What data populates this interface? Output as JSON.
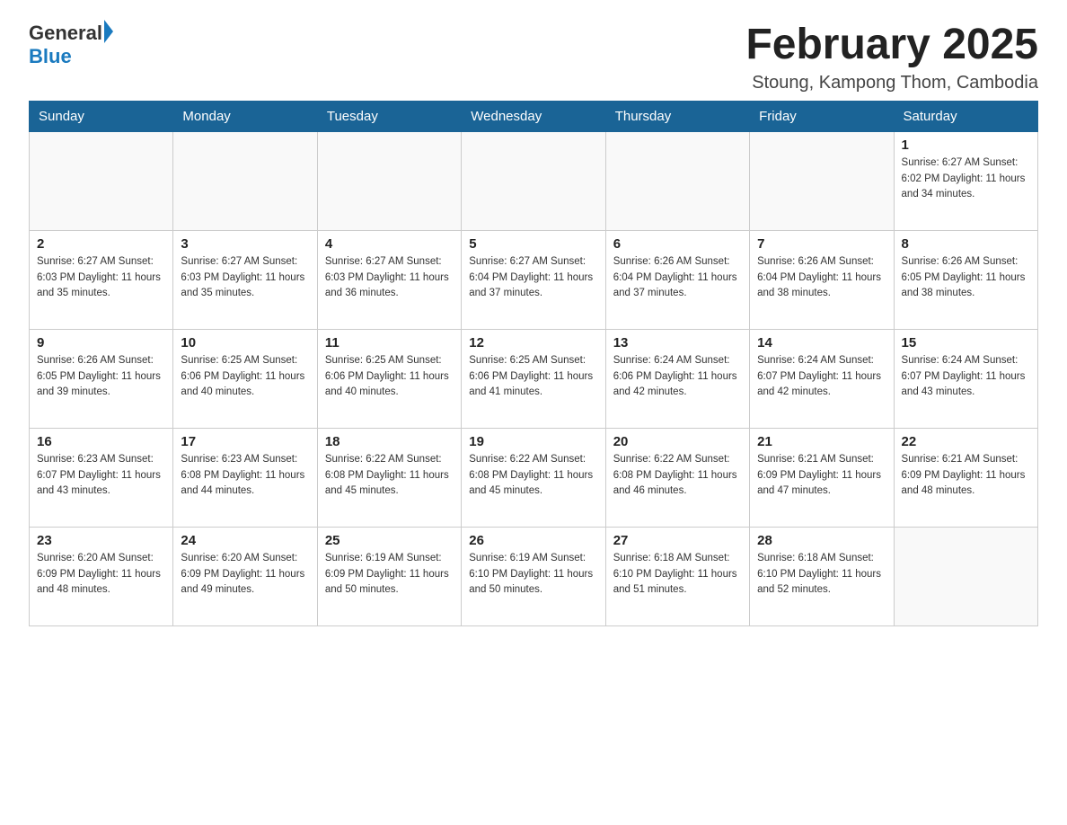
{
  "header": {
    "logo_general": "General",
    "logo_blue": "Blue",
    "title": "February 2025",
    "subtitle": "Stoung, Kampong Thom, Cambodia"
  },
  "weekdays": [
    "Sunday",
    "Monday",
    "Tuesday",
    "Wednesday",
    "Thursday",
    "Friday",
    "Saturday"
  ],
  "weeks": [
    [
      {
        "day": "",
        "info": ""
      },
      {
        "day": "",
        "info": ""
      },
      {
        "day": "",
        "info": ""
      },
      {
        "day": "",
        "info": ""
      },
      {
        "day": "",
        "info": ""
      },
      {
        "day": "",
        "info": ""
      },
      {
        "day": "1",
        "info": "Sunrise: 6:27 AM\nSunset: 6:02 PM\nDaylight: 11 hours\nand 34 minutes."
      }
    ],
    [
      {
        "day": "2",
        "info": "Sunrise: 6:27 AM\nSunset: 6:03 PM\nDaylight: 11 hours\nand 35 minutes."
      },
      {
        "day": "3",
        "info": "Sunrise: 6:27 AM\nSunset: 6:03 PM\nDaylight: 11 hours\nand 35 minutes."
      },
      {
        "day": "4",
        "info": "Sunrise: 6:27 AM\nSunset: 6:03 PM\nDaylight: 11 hours\nand 36 minutes."
      },
      {
        "day": "5",
        "info": "Sunrise: 6:27 AM\nSunset: 6:04 PM\nDaylight: 11 hours\nand 37 minutes."
      },
      {
        "day": "6",
        "info": "Sunrise: 6:26 AM\nSunset: 6:04 PM\nDaylight: 11 hours\nand 37 minutes."
      },
      {
        "day": "7",
        "info": "Sunrise: 6:26 AM\nSunset: 6:04 PM\nDaylight: 11 hours\nand 38 minutes."
      },
      {
        "day": "8",
        "info": "Sunrise: 6:26 AM\nSunset: 6:05 PM\nDaylight: 11 hours\nand 38 minutes."
      }
    ],
    [
      {
        "day": "9",
        "info": "Sunrise: 6:26 AM\nSunset: 6:05 PM\nDaylight: 11 hours\nand 39 minutes."
      },
      {
        "day": "10",
        "info": "Sunrise: 6:25 AM\nSunset: 6:06 PM\nDaylight: 11 hours\nand 40 minutes."
      },
      {
        "day": "11",
        "info": "Sunrise: 6:25 AM\nSunset: 6:06 PM\nDaylight: 11 hours\nand 40 minutes."
      },
      {
        "day": "12",
        "info": "Sunrise: 6:25 AM\nSunset: 6:06 PM\nDaylight: 11 hours\nand 41 minutes."
      },
      {
        "day": "13",
        "info": "Sunrise: 6:24 AM\nSunset: 6:06 PM\nDaylight: 11 hours\nand 42 minutes."
      },
      {
        "day": "14",
        "info": "Sunrise: 6:24 AM\nSunset: 6:07 PM\nDaylight: 11 hours\nand 42 minutes."
      },
      {
        "day": "15",
        "info": "Sunrise: 6:24 AM\nSunset: 6:07 PM\nDaylight: 11 hours\nand 43 minutes."
      }
    ],
    [
      {
        "day": "16",
        "info": "Sunrise: 6:23 AM\nSunset: 6:07 PM\nDaylight: 11 hours\nand 43 minutes."
      },
      {
        "day": "17",
        "info": "Sunrise: 6:23 AM\nSunset: 6:08 PM\nDaylight: 11 hours\nand 44 minutes."
      },
      {
        "day": "18",
        "info": "Sunrise: 6:22 AM\nSunset: 6:08 PM\nDaylight: 11 hours\nand 45 minutes."
      },
      {
        "day": "19",
        "info": "Sunrise: 6:22 AM\nSunset: 6:08 PM\nDaylight: 11 hours\nand 45 minutes."
      },
      {
        "day": "20",
        "info": "Sunrise: 6:22 AM\nSunset: 6:08 PM\nDaylight: 11 hours\nand 46 minutes."
      },
      {
        "day": "21",
        "info": "Sunrise: 6:21 AM\nSunset: 6:09 PM\nDaylight: 11 hours\nand 47 minutes."
      },
      {
        "day": "22",
        "info": "Sunrise: 6:21 AM\nSunset: 6:09 PM\nDaylight: 11 hours\nand 48 minutes."
      }
    ],
    [
      {
        "day": "23",
        "info": "Sunrise: 6:20 AM\nSunset: 6:09 PM\nDaylight: 11 hours\nand 48 minutes."
      },
      {
        "day": "24",
        "info": "Sunrise: 6:20 AM\nSunset: 6:09 PM\nDaylight: 11 hours\nand 49 minutes."
      },
      {
        "day": "25",
        "info": "Sunrise: 6:19 AM\nSunset: 6:09 PM\nDaylight: 11 hours\nand 50 minutes."
      },
      {
        "day": "26",
        "info": "Sunrise: 6:19 AM\nSunset: 6:10 PM\nDaylight: 11 hours\nand 50 minutes."
      },
      {
        "day": "27",
        "info": "Sunrise: 6:18 AM\nSunset: 6:10 PM\nDaylight: 11 hours\nand 51 minutes."
      },
      {
        "day": "28",
        "info": "Sunrise: 6:18 AM\nSunset: 6:10 PM\nDaylight: 11 hours\nand 52 minutes."
      },
      {
        "day": "",
        "info": ""
      }
    ]
  ]
}
